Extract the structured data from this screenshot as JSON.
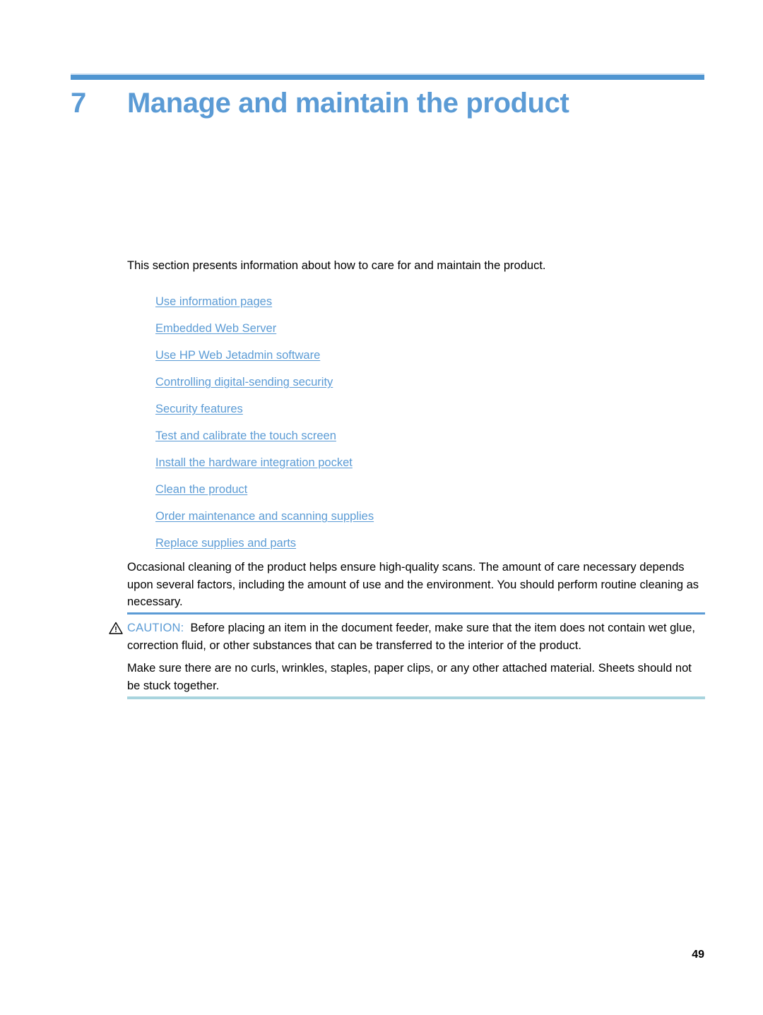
{
  "document": {
    "chapter_number": "7",
    "chapter_title": "Manage and maintain the product",
    "page_number": "49"
  },
  "colors": {
    "accent_blue": "#5b9bd5",
    "rule_blue": "#4f95d1",
    "rule_light": "#c8ddf1",
    "note_rule_bottom": "#a8d4de"
  },
  "intro": {
    "text": "This section presents information about how to care for and maintain the product."
  },
  "toc": {
    "links": [
      {
        "label": "Use information pages"
      },
      {
        "label": "Embedded Web Server"
      },
      {
        "label": "Use HP Web Jetadmin software"
      },
      {
        "label": "Controlling digital-sending security"
      },
      {
        "label": "Security features"
      },
      {
        "label": "Test and calibrate the touch screen"
      },
      {
        "label": "Install the hardware integration pocket"
      },
      {
        "label": "Clean the product"
      },
      {
        "label": "Order maintenance and scanning supplies"
      },
      {
        "label": "Replace supplies and parts"
      }
    ]
  },
  "paragraphs": {
    "cleaning": "Occasional cleaning of the product helps ensure high-quality scans. The amount of care necessary depends upon several factors, including the amount of use and the environment. You should perform routine cleaning as necessary.",
    "sheets": "Make sure there are no curls, wrinkles, staples, paper clips, or any other attached material. Sheets should not be stuck together."
  },
  "caution": {
    "icon": "warning-triangle-icon",
    "label": "CAUTION:",
    "text": "Before placing an item in the document feeder, make sure that the item does not contain wet glue, correction fluid, or other substances that can be transferred to the interior of the product."
  }
}
